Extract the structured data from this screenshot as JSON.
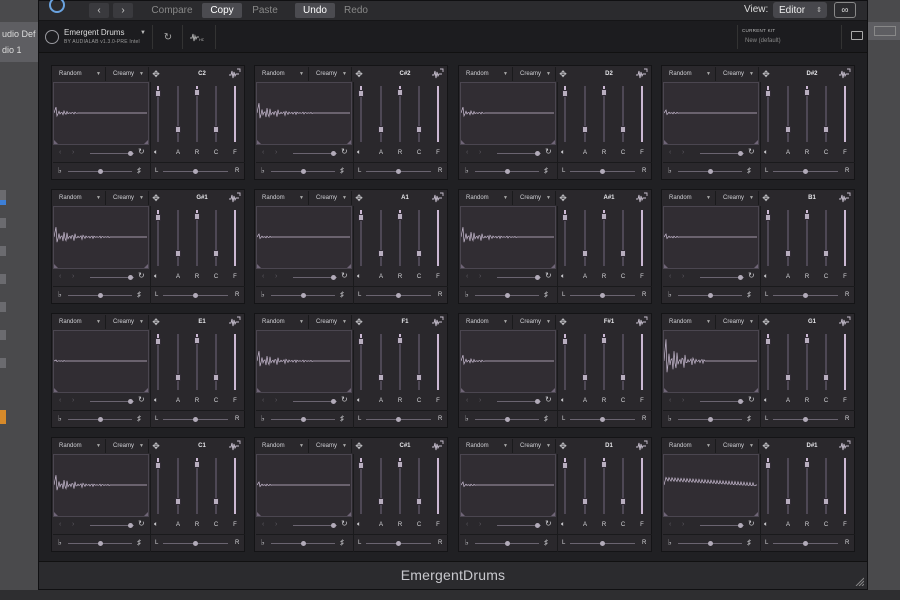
{
  "host": {
    "track_name_1": "udio Def",
    "track_name_2": "dio 1"
  },
  "toolbar": {
    "back_label": "‹",
    "forward_label": "›",
    "compare_label": "Compare",
    "copy_label": "Copy",
    "paste_label": "Paste",
    "undo_label": "Undo",
    "redo_label": "Redo",
    "view_label": "View:",
    "view_value": "Editor",
    "link_icon": "link-icon"
  },
  "header": {
    "plugin_name": "Emergent Drums",
    "plugin_sub": "BY AUDIALAB  v1.3.0-PRE Intel",
    "current_kit_label": "CURRENT KIT",
    "current_kit_value": "New (default)"
  },
  "pad_common": {
    "random_label": "Random",
    "creamy_label": "Creamy",
    "a_label": "A",
    "r_label": "R",
    "c_label": "C",
    "f_label": "F",
    "l_label": "L",
    "r2_label": "R",
    "flat_symbol": "♭",
    "sharp_symbol": "♯"
  },
  "pads": [
    {
      "note": "C2",
      "wave": "short"
    },
    {
      "note": "C#2",
      "wave": "long"
    },
    {
      "note": "D2",
      "wave": "short"
    },
    {
      "note": "D#2",
      "wave": "tiny"
    },
    {
      "note": "G#1",
      "wave": "long"
    },
    {
      "note": "A1",
      "wave": "tiny"
    },
    {
      "note": "A#1",
      "wave": "long"
    },
    {
      "note": "B1",
      "wave": "tiny"
    },
    {
      "note": "E1",
      "wave": "flat"
    },
    {
      "note": "F1",
      "wave": "long"
    },
    {
      "note": "F#1",
      "wave": "short"
    },
    {
      "note": "G1",
      "wave": "big"
    },
    {
      "note": "C1",
      "wave": "long"
    },
    {
      "note": "C#1",
      "wave": "tiny"
    },
    {
      "note": "D1",
      "wave": "tiny"
    },
    {
      "note": "D#1",
      "wave": "sustain"
    }
  ],
  "footer": {
    "title": "EmergentDrums"
  }
}
